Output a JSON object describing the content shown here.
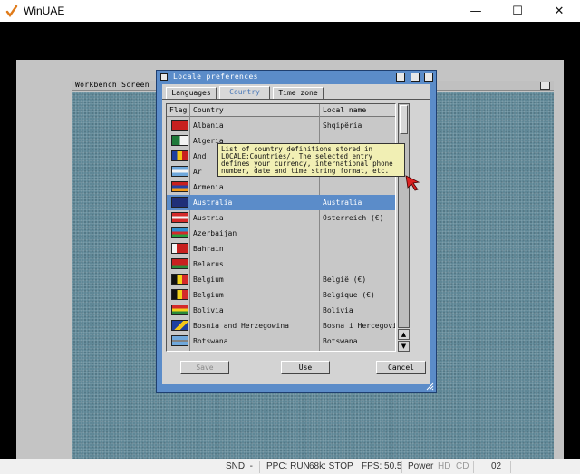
{
  "window": {
    "title": "WinUAE",
    "controls": {
      "minimize": "—",
      "maximize": "☐",
      "close": "✕"
    }
  },
  "workbench": {
    "screen_title": "Workbench Screen"
  },
  "locale_window": {
    "title": "Locale preferences",
    "tabs": [
      {
        "label": "Languages",
        "active": false
      },
      {
        "label": "Country",
        "active": true
      },
      {
        "label": "Time zone",
        "active": false
      }
    ],
    "columns": {
      "flag": "Flag",
      "country": "Country",
      "local_name": "Local name"
    },
    "rows": [
      {
        "country": "Albania",
        "local": "Shqipëria",
        "flag": "albania-flag",
        "selected": false
      },
      {
        "country": "Algeria",
        "local": "",
        "flag": "algeria-flag",
        "selected": false
      },
      {
        "country": "And",
        "local": "",
        "flag": "andorra-flag",
        "selected": false
      },
      {
        "country": "Ar",
        "local": "",
        "flag": "argentina-flag",
        "selected": false
      },
      {
        "country": "Armenia",
        "local": "",
        "flag": "armenia-flag",
        "selected": false
      },
      {
        "country": "Australia",
        "local": "Australia",
        "flag": "australia-flag",
        "selected": true
      },
      {
        "country": "Austria",
        "local": "Österreich (€)",
        "flag": "austria-flag",
        "selected": false
      },
      {
        "country": "Azerbaijan",
        "local": "",
        "flag": "azerbaijan-flag",
        "selected": false
      },
      {
        "country": "Bahrain",
        "local": "",
        "flag": "bahrain-flag",
        "selected": false
      },
      {
        "country": "Belarus",
        "local": "",
        "flag": "belarus-flag",
        "selected": false
      },
      {
        "country": "Belgium",
        "local": "België (€)",
        "flag": "belgium-flag",
        "selected": false
      },
      {
        "country": "Belgium",
        "local": "Belgique (€)",
        "flag": "belgium-flag",
        "selected": false
      },
      {
        "country": "Bolivia",
        "local": "Bolivia",
        "flag": "bolivia-flag",
        "selected": false
      },
      {
        "country": "Bosnia and Herzegowina",
        "local": "Bosna i Hercegovi",
        "flag": "bosnia-flag",
        "selected": false
      },
      {
        "country": "Botswana",
        "local": "Botswana",
        "flag": "botswana-flag",
        "selected": false
      }
    ],
    "tooltip": [
      "List of country definitions stored in",
      "LOCALE:Countries/. The selected entry",
      "defines your currency, international phone",
      "number, date and time string format, etc."
    ],
    "buttons": {
      "save": "Save",
      "use": "Use",
      "cancel": "Cancel"
    },
    "scroll": {
      "up": "▲",
      "down": "▼"
    }
  },
  "status_bar": {
    "snd": "SND: -",
    "ppc": "PPC: RUN",
    "chip": "68k: STOP",
    "fps": "FPS: 50.5",
    "power": "Power",
    "hd": "HD",
    "cd": "CD",
    "drive": "02"
  },
  "colors": {
    "accent_blue": "#5b8cc9",
    "desktop": "#5f8796",
    "tooltip_bg": "#f1efb4",
    "flag_albania": "#c8201f",
    "flag_algeria_green": "#1f7a3a",
    "flag_andorra_blue": "#1e3fa0",
    "flag_andorra_yellow": "#f2c619",
    "flag_andorra_red": "#c8201f",
    "flag_argentina": "#6fa8dc",
    "flag_armenia_red": "#c8201f",
    "flag_armenia_blue": "#2343a5",
    "flag_armenia_orange": "#f29b1a",
    "flag_australia": "#1f2f78",
    "flag_austria_red": "#d42a2a",
    "flag_azerbaijan_blue": "#2c8fd0",
    "flag_azerbaijan_red": "#d42a2a",
    "flag_azerbaijan_green": "#28a040",
    "flag_bahrain": "#c8201f",
    "flag_belarus_red": "#c8201f",
    "flag_belarus_green": "#2a8a3a",
    "flag_belgium_black": "#111111",
    "flag_belgium_yellow": "#f2d21b",
    "flag_belgium_red": "#d42a2a",
    "flag_bolivia_red": "#d42a2a",
    "flag_bolivia_yellow": "#f2d21b",
    "flag_bolivia_green": "#2a8a3a",
    "flag_bosnia_blue": "#1e3fa0",
    "flag_bosnia_yellow": "#f2c619",
    "flag_botswana_blue": "#6fa8dc",
    "flag_botswana_black": "#111111"
  }
}
